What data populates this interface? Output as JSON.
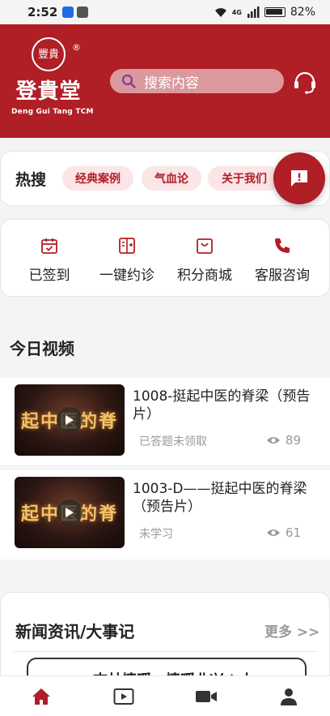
{
  "status_bar": {
    "time": "2:52",
    "battery": "82%",
    "network": "4G"
  },
  "header": {
    "brand_name": "登貴堂",
    "brand_en": "Deng Gui Tang  TCM",
    "seal_text": "豐貴",
    "reg_mark": "®",
    "search_placeholder": "搜索内容"
  },
  "hot_search": {
    "title": "热搜",
    "tags": [
      "经典案例",
      "气血论",
      "关于我们"
    ]
  },
  "actions": [
    {
      "label": "已签到",
      "icon": "calendar-check-icon"
    },
    {
      "label": "一键约诊",
      "icon": "hospital-icon"
    },
    {
      "label": "积分商城",
      "icon": "shopping-bag-icon"
    },
    {
      "label": "客服咨询",
      "icon": "phone-icon"
    }
  ],
  "today_video": {
    "title": "今日视频",
    "thumbnail_caption": "起中医的脊",
    "items": [
      {
        "title": "1008-挺起中医的脊梁（预告片）",
        "status": "已答题未领取",
        "views": "89"
      },
      {
        "title": "1003-D——挺起中医的脊梁（预告片）",
        "status": "未学习",
        "views": "61"
      }
    ]
  },
  "news": {
    "title": "新闻资讯/大事记",
    "more": "更多 >>",
    "first_item": "杏林情暖，情暖业兴 | 大"
  },
  "colors": {
    "brand_red": "#b01e26",
    "tag_bg": "#fbe5e6"
  },
  "bottom_nav": [
    {
      "name": "home-icon",
      "active": true
    },
    {
      "name": "video-icon",
      "active": false
    },
    {
      "name": "camera-icon",
      "active": false
    },
    {
      "name": "profile-icon",
      "active": false
    }
  ]
}
